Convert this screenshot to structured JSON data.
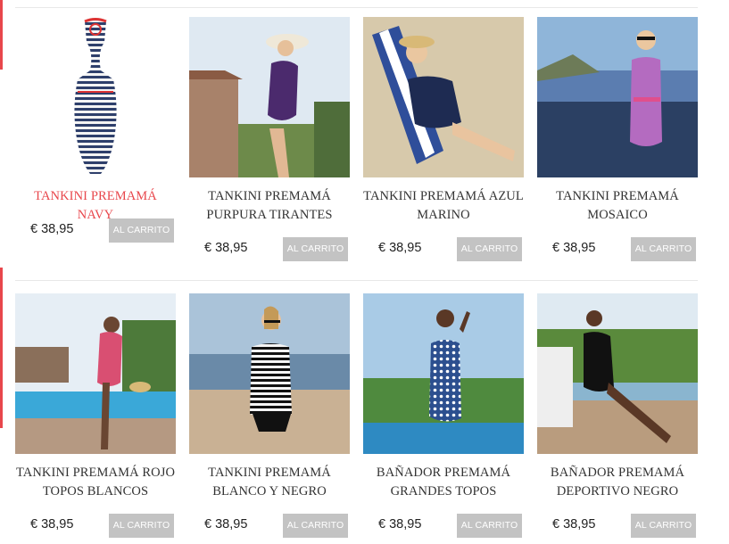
{
  "products": [
    {
      "name": "TANKINI PREMAMÁ NAVY",
      "price": "€ 38,95",
      "cart_label": "AL CARRITO",
      "active": true
    },
    {
      "name": "TANKINI PREMAMÁ PURPURA TIRANTES",
      "price": "€ 38,95",
      "cart_label": "AL CARRITO"
    },
    {
      "name": "TANKINI PREMAMÁ AZUL MARINO",
      "price": "€ 38,95",
      "cart_label": "AL CARRITO"
    },
    {
      "name": "TANKINI PREMAMÁ MOSAICO",
      "price": "€ 38,95",
      "cart_label": "AL CARRITO"
    },
    {
      "name": "TANKINI PREMAMÁ ROJO TOPOS BLANCOS",
      "price": "€ 38,95",
      "cart_label": "AL CARRITO"
    },
    {
      "name": "TANKINI PREMAMÁ BLANCO Y NEGRO",
      "price": "€ 38,95",
      "cart_label": "AL CARRITO"
    },
    {
      "name": "BAÑADOR PREMAMÁ GRANDES TOPOS",
      "price": "€ 38,95",
      "cart_label": "AL CARRITO"
    },
    {
      "name": "BAÑADOR PREMAMÁ DEPORTIVO NEGRO",
      "price": "€ 38,95",
      "cart_label": "AL CARRITO"
    }
  ],
  "colors": {
    "accent": "#e8474c",
    "button_bg": "#c3c3c3",
    "text": "#333333"
  }
}
